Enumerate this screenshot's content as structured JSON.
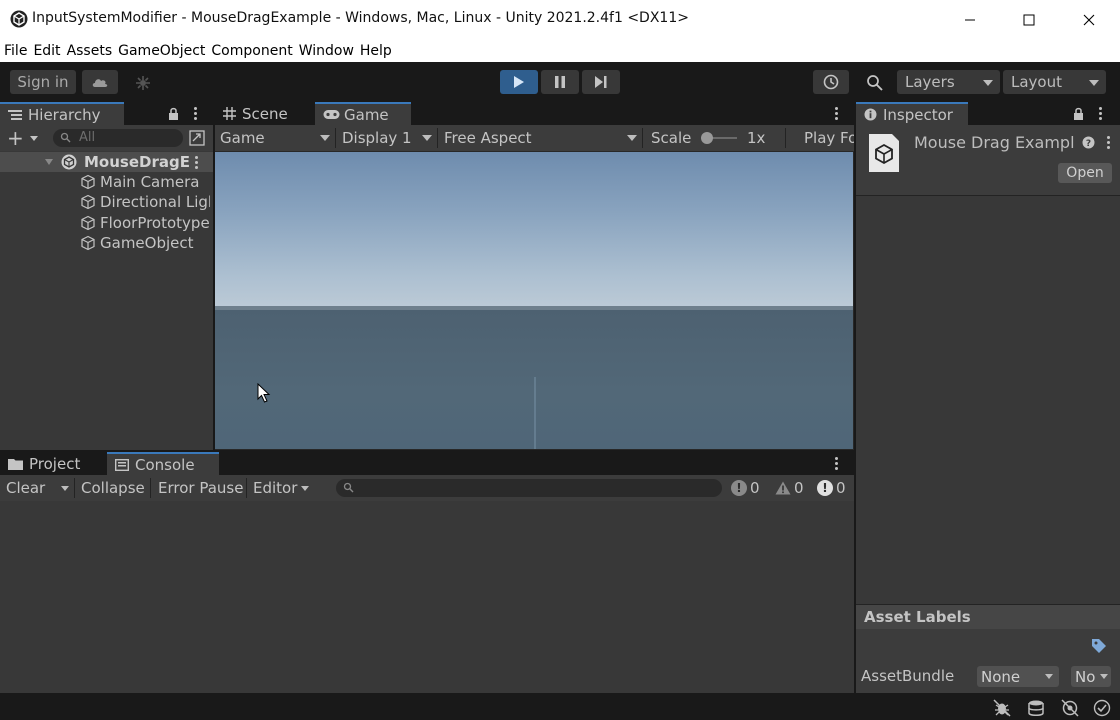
{
  "window": {
    "title": "InputSystemModifier - MouseDragExample - Windows, Mac, Linux - Unity 2021.2.4f1 <DX11>"
  },
  "menu": [
    "File",
    "Edit",
    "Assets",
    "GameObject",
    "Component",
    "Window",
    "Help"
  ],
  "toolbar": {
    "sign_in": "Sign in",
    "layers": "Layers",
    "layout": "Layout"
  },
  "hierarchy": {
    "tab_label": "Hierarchy",
    "add_label": "+",
    "search_placeholder": "All",
    "scene_name": "MouseDragE:",
    "items": [
      "Main Camera",
      "Directional Ligl",
      "FloorPrototype",
      "GameObject"
    ]
  },
  "scene_tab": "Scene",
  "game": {
    "tab_label": "Game",
    "mode": "Game",
    "display": "Display 1",
    "aspect": "Free Aspect",
    "scale_label": "Scale",
    "scale_value": "1x",
    "play_focused": "Play Fo"
  },
  "inspector": {
    "tab_label": "Inspector",
    "asset_name": "Mouse Drag Exampl",
    "open_button": "Open",
    "asset_labels": "Asset Labels",
    "assetbundle_label": "AssetBundle",
    "assetbundle_value": "None",
    "variant_value": "No"
  },
  "project_tab": "Project",
  "console": {
    "tab_label": "Console",
    "clear": "Clear",
    "collapse": "Collapse",
    "error_pause": "Error Pause",
    "editor": "Editor",
    "info_count": "0",
    "warn_count": "0",
    "error_count": "0"
  },
  "colors": {
    "accent": "#3a79bb",
    "play_active": "#2f5e8e"
  }
}
